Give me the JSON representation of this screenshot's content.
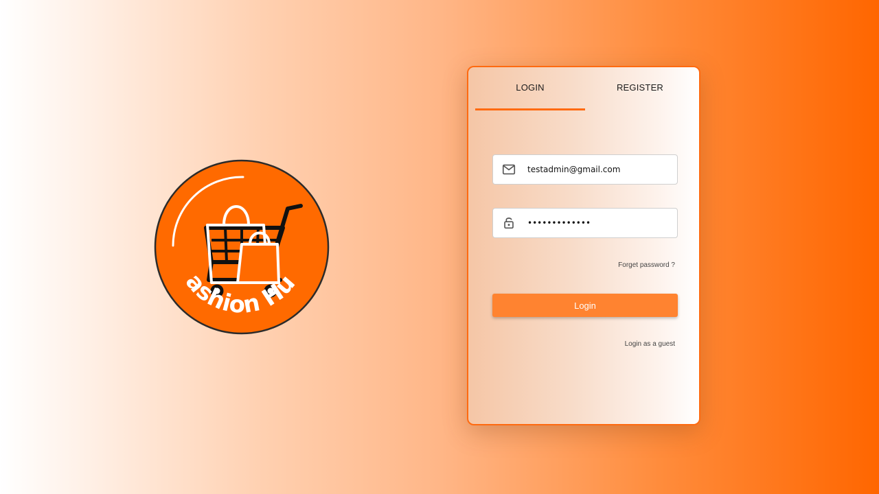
{
  "brand": {
    "name": "Fashion Hub",
    "primary_color": "#ff6600",
    "icon": "shopping-cart-with-bags-icon"
  },
  "tabs": [
    {
      "label": "LOGIN",
      "active": true
    },
    {
      "label": "REGISTER",
      "active": false
    }
  ],
  "form": {
    "email": {
      "value": "testadmin@gmail.com",
      "icon": "mail-icon"
    },
    "password": {
      "value": "•••••••••••••",
      "icon": "lock-icon"
    },
    "forget_password": "Forget password ?",
    "login_button": "Login",
    "guest_link": "Login as a guest"
  }
}
